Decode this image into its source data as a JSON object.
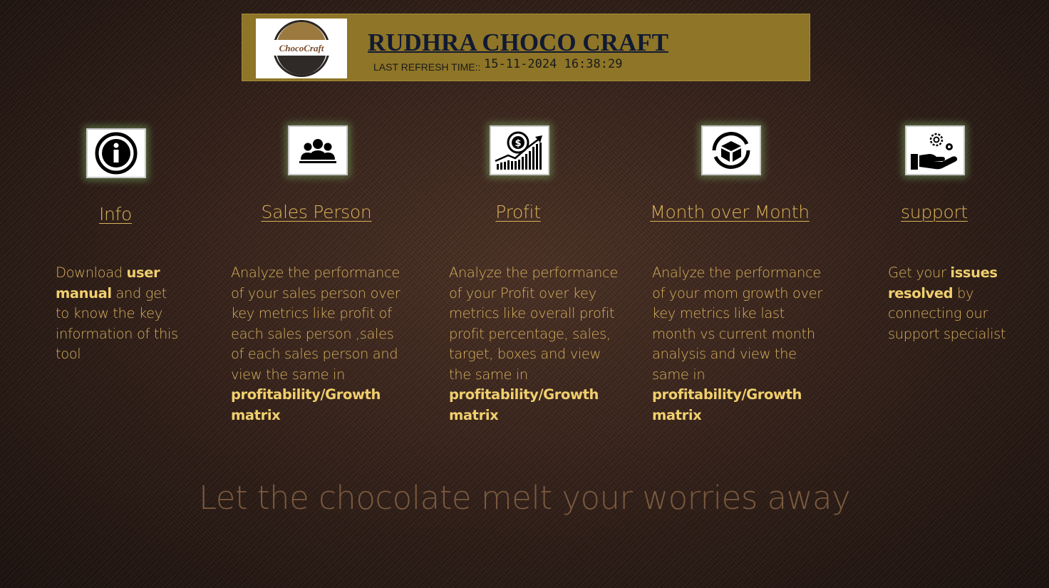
{
  "header": {
    "logo_text": "ChocoCraft",
    "title": "RUDHRA CHOCO CRAFT",
    "refresh_label": "LAST REFRESH TIME::",
    "refresh_value": "15-11-2024 16:38:29"
  },
  "nav": [
    {
      "icon": "info-icon",
      "label": "Info",
      "desc_pre": "Download ",
      "desc_bold": "user manual",
      "desc_post": " and get to know the key information of this tool"
    },
    {
      "icon": "team-icon",
      "label": "Sales Person",
      "desc_pre": "Analyze the performance of your sales person over key metrics like profit of each sales person ,sales of each sales person and view the same in ",
      "desc_bold": "profitability/Growth matrix",
      "desc_post": ""
    },
    {
      "icon": "profit-chart-icon",
      "label": "Profit",
      "desc_pre": "Analyze the performance of your Profit over key metrics like overall profit profit percentage, sales, target, boxes and view the same in ",
      "desc_bold": "profitability/Growth matrix",
      "desc_post": ""
    },
    {
      "icon": "box-cycle-icon",
      "label": "Month over Month",
      "desc_pre": "Analyze the performance of your mom growth over key metrics like last month vs current month analysis  and view the same in ",
      "desc_bold": "profitability/Growth matrix",
      "desc_post": ""
    },
    {
      "icon": "support-hand-gears-icon",
      "label": "support",
      "desc_pre": "Get your ",
      "desc_bold": "issues resolved",
      "desc_post": " by connecting our support specialist"
    }
  ],
  "tagline": "Let the chocolate melt your worries away",
  "colors": {
    "header_bg": "#8e7527",
    "link": "#d9b35a",
    "text": "#d6b15e",
    "tagline": "#7a5a3f",
    "title": "#111a33"
  }
}
